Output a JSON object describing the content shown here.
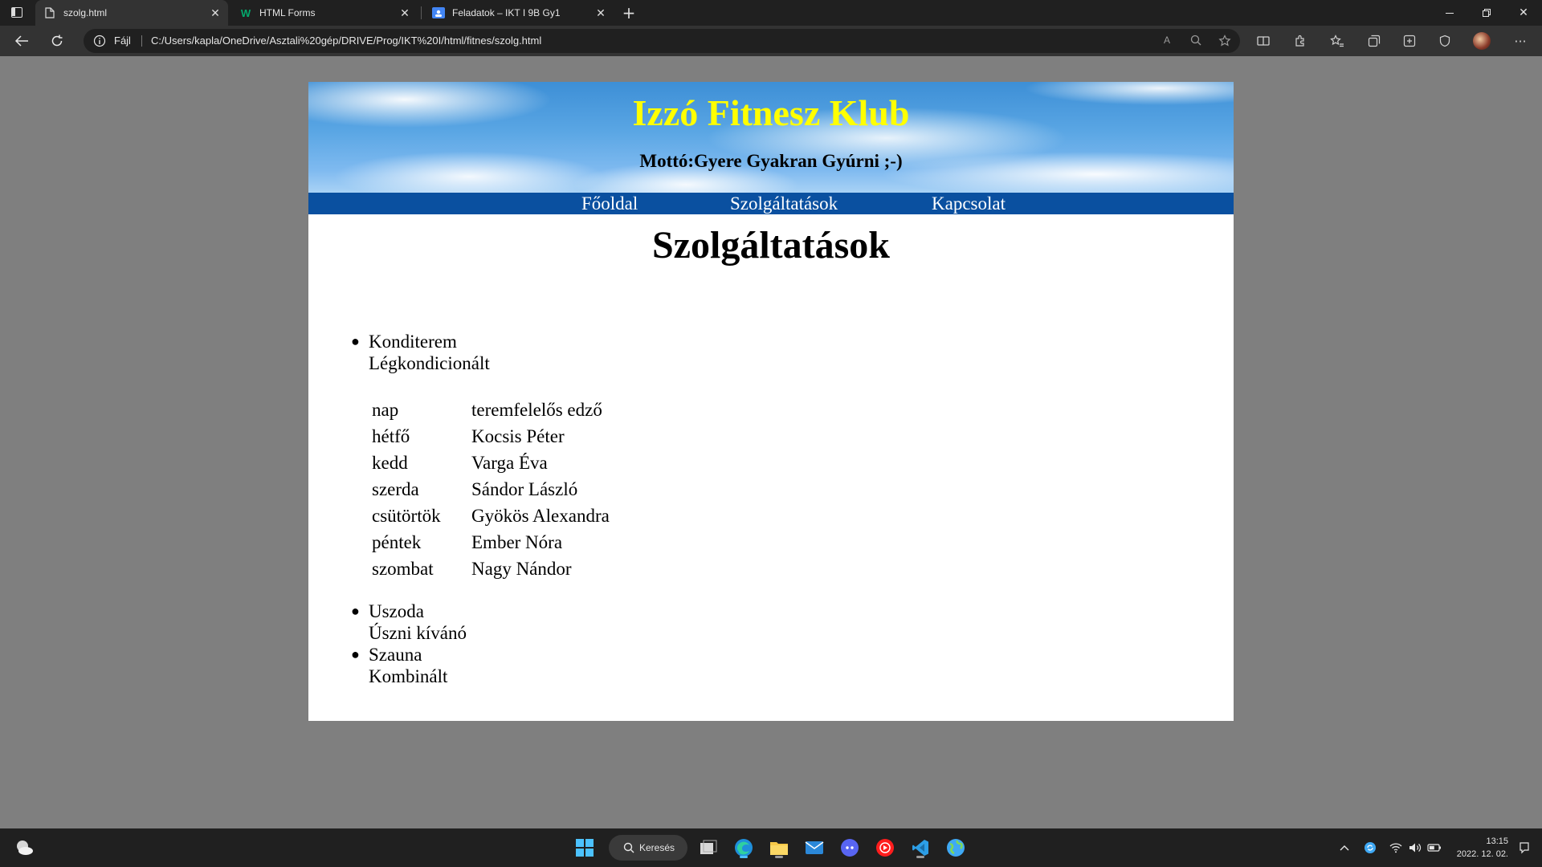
{
  "browser": {
    "tabs": [
      {
        "title": "szolg.html",
        "icon": "document-icon"
      },
      {
        "title": "HTML Forms",
        "icon": "w3schools-icon"
      },
      {
        "title": "Feladatok – IKT I 9B Gy1",
        "icon": "classroom-icon"
      }
    ],
    "address_protocol": "Fájl",
    "url": "C:/Users/kapla/OneDrive/Asztali%20gép/DRIVE/Prog/IKT%20I/html/fitnes/szolg.html",
    "read_aloud": "A",
    "window_controls": [
      "minimize-icon",
      "restore-icon",
      "close-icon"
    ]
  },
  "site": {
    "title": "Izzó Fitnesz Klub",
    "motto": "Mottó:Gyere Gyakran Gyúrni ;-)",
    "nav": [
      "Főoldal",
      "Szolgáltatások",
      "Kapcsolat"
    ],
    "title_color": "#ffff00",
    "nav_color": "#0a50a0"
  },
  "page": {
    "heading": "Szolgáltatások",
    "services": [
      {
        "name": "Konditerem",
        "desc": "Légkondicionált"
      },
      {
        "name": "Uszoda",
        "desc": "Úszni kívánó"
      },
      {
        "name": "Szauna",
        "desc": "Kombinált"
      }
    ],
    "schedule": {
      "header": [
        "nap",
        "teremfelelős edző"
      ],
      "rows": [
        [
          "hétfő",
          "Kocsis Péter"
        ],
        [
          "kedd",
          "Varga Éva"
        ],
        [
          "szerda",
          "Sándor László"
        ],
        [
          "csütörtök",
          "Gyökös Alexandra"
        ],
        [
          "péntek",
          "Ember Nóra"
        ],
        [
          "szombat",
          "Nagy Nándor"
        ]
      ]
    }
  },
  "taskbar": {
    "search_label": "Keresés",
    "time": "13:15",
    "date": "2022. 12. 02."
  }
}
